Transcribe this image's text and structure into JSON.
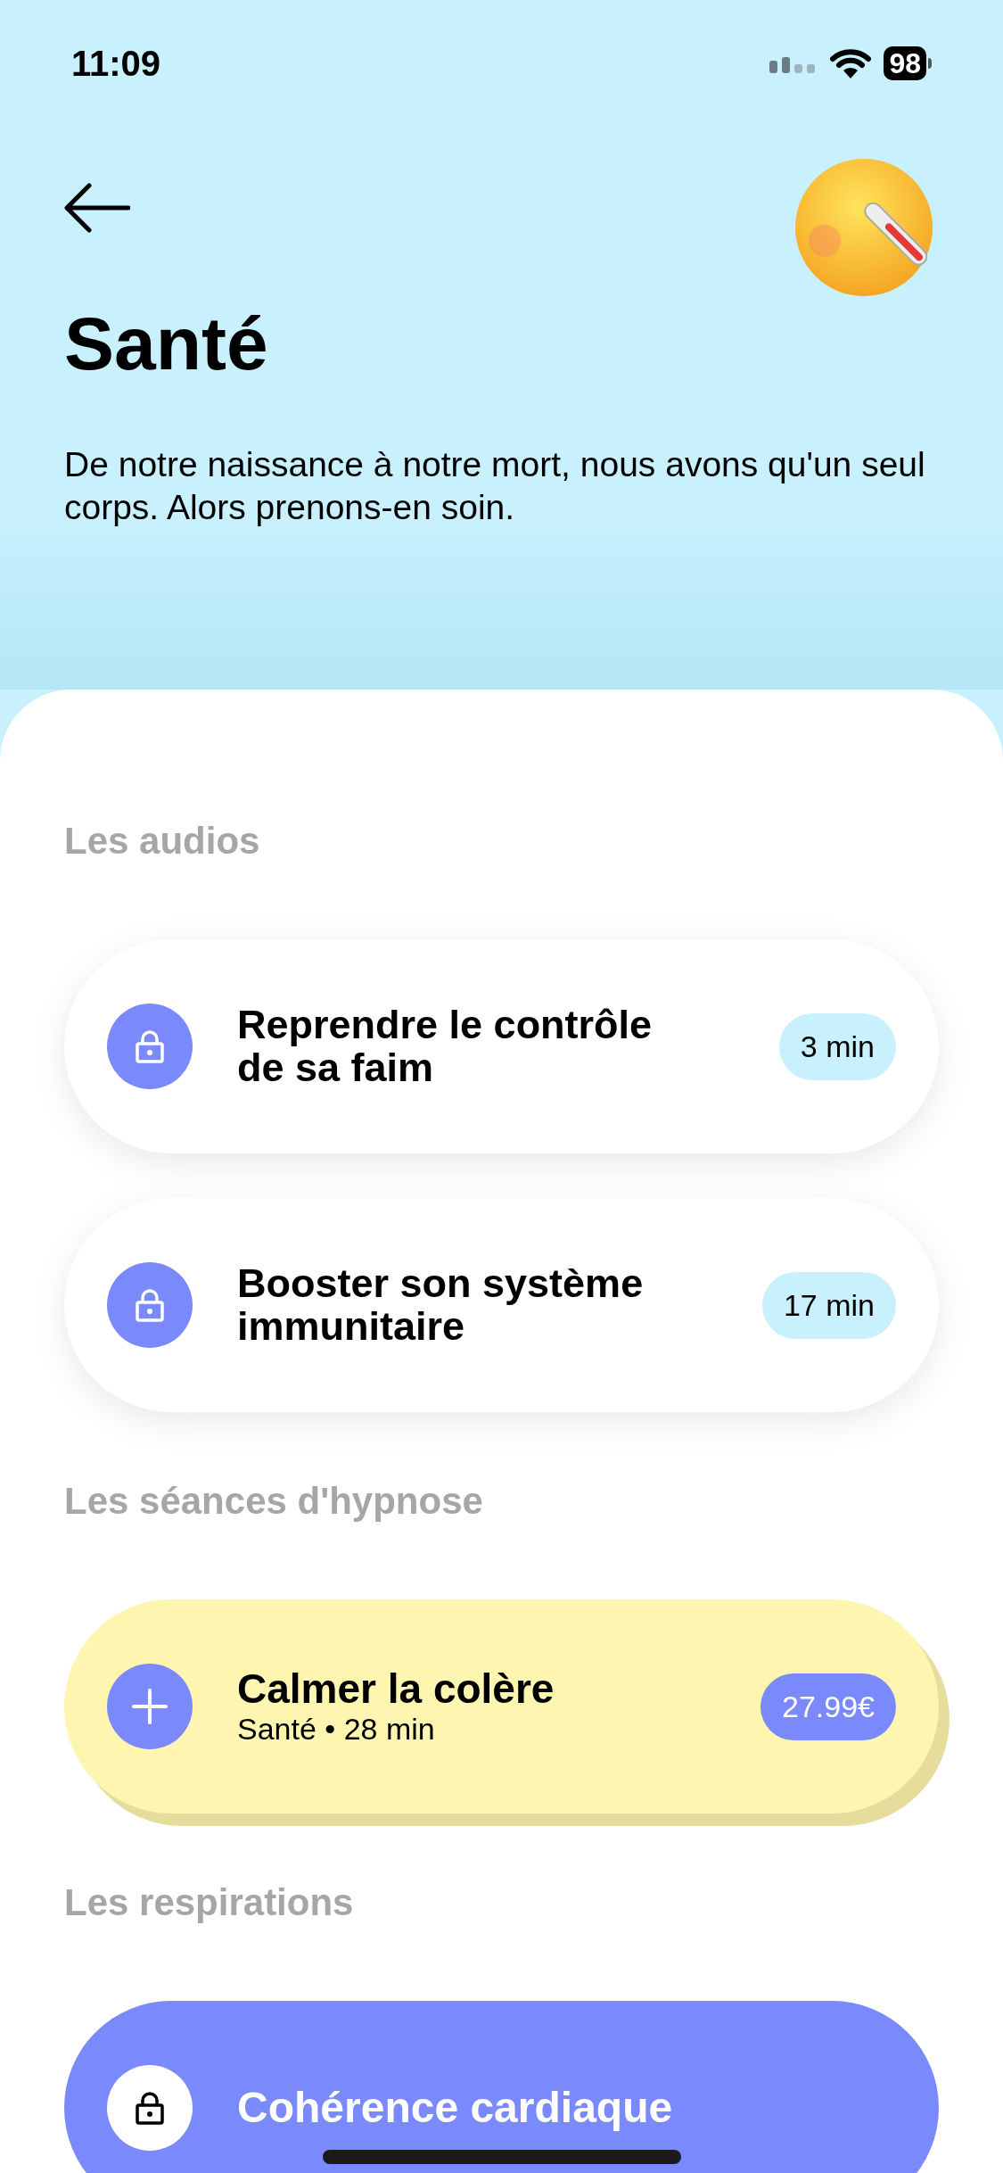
{
  "status_bar": {
    "time": "11:09",
    "battery": "98"
  },
  "header": {
    "title": "Santé",
    "description": "De notre naissance à notre mort, nous avons qu'un seul corps. Alors prenons-en soin."
  },
  "sections": [
    {
      "title": "Les audios",
      "items": [
        {
          "kind": "audio",
          "title": "Reprendre le contrôle de sa faim",
          "badge": "3 min"
        },
        {
          "kind": "audio",
          "title": "Booster son système immunitaire",
          "badge": "17 min"
        }
      ]
    },
    {
      "title": "Les séances d'hypnose",
      "items": [
        {
          "kind": "session",
          "title": "Calmer la colère",
          "subtitle": "Santé • 28 min",
          "badge": "27.99€"
        }
      ]
    },
    {
      "title": "Les respirations",
      "items": [
        {
          "kind": "breathing",
          "title": "Cohérence cardiaque"
        }
      ]
    }
  ]
}
